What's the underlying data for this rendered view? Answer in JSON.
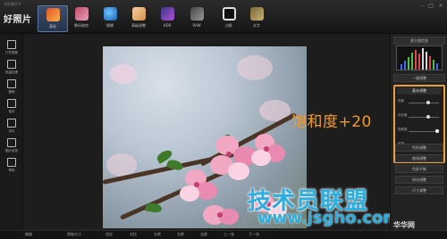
{
  "app": {
    "logo": "好照片",
    "window_title": "光影魔术手"
  },
  "toolbar": {
    "tools": [
      {
        "label": "基础"
      },
      {
        "label": "数码暗房"
      },
      {
        "label": "模糊"
      },
      {
        "label": "高级调整"
      },
      {
        "label": "HDR"
      },
      {
        "label": "RAW"
      },
      {
        "label": "边框"
      },
      {
        "label": "文字"
      }
    ]
  },
  "leftbar": {
    "items": [
      {
        "label": "打开图像"
      },
      {
        "label": "批量处理"
      },
      {
        "label": "撤销"
      },
      {
        "label": "保存"
      },
      {
        "label": "另存"
      },
      {
        "label": "图片信息"
      },
      {
        "label": "帮助"
      }
    ]
  },
  "canvas": {
    "overlay_text": "饱和度+20",
    "watermark": "技术员联盟",
    "watermark_url": "www.jsgho.com"
  },
  "rightpanel": {
    "histogram_title": "直方图信息",
    "oneclick": "一键调整",
    "basic_title": "基本调整",
    "sliders": [
      {
        "label": "亮度",
        "value": 0.55
      },
      {
        "label": "对比度",
        "value": 0.55
      },
      {
        "label": "饱和度",
        "value": 0.72
      },
      {
        "label": "色相",
        "value": 0.55
      }
    ],
    "buttons": [
      {
        "label": "色阶调整"
      },
      {
        "label": "曲线调整"
      },
      {
        "label": "色彩平衡"
      },
      {
        "label": "锐化调整"
      },
      {
        "label": "尺寸调整"
      }
    ]
  },
  "bottombar": {
    "items": [
      {
        "label": "缩放"
      },
      {
        "label": "原始大小"
      },
      {
        "label": "适应"
      },
      {
        "label": "对比"
      },
      {
        "label": "左转"
      },
      {
        "label": "右转"
      },
      {
        "label": "全屏"
      },
      {
        "label": "上一张"
      },
      {
        "label": "下一张"
      }
    ],
    "site": "华华网"
  },
  "colors": {
    "accent_orange": "#f39a2a",
    "active_blue": "#3d4e6a",
    "watermark_blue": "#2aaee0"
  }
}
